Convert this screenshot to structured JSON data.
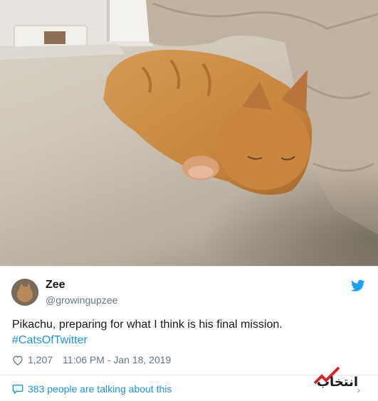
{
  "tweet": {
    "display_name": "Zee",
    "handle": "@growingupzee",
    "text": "Pikachu, preparing for what I think is his final mission.",
    "hashtag": "#CatsOfTwitter",
    "likes": "1,207",
    "timestamp": "11:06 PM - Jan 18, 2019",
    "talking": "383 people are talking about this"
  },
  "icons": {
    "platform": "twitter-bird-icon",
    "like": "heart-icon",
    "comment": "speech-bubble-icon",
    "more": "chevron-right-icon"
  },
  "colors": {
    "link": "#1b95e0",
    "muted": "#657786",
    "text": "#14171a",
    "logo_red": "#d7262e"
  },
  "watermark": {
    "text": "انتخاب"
  }
}
